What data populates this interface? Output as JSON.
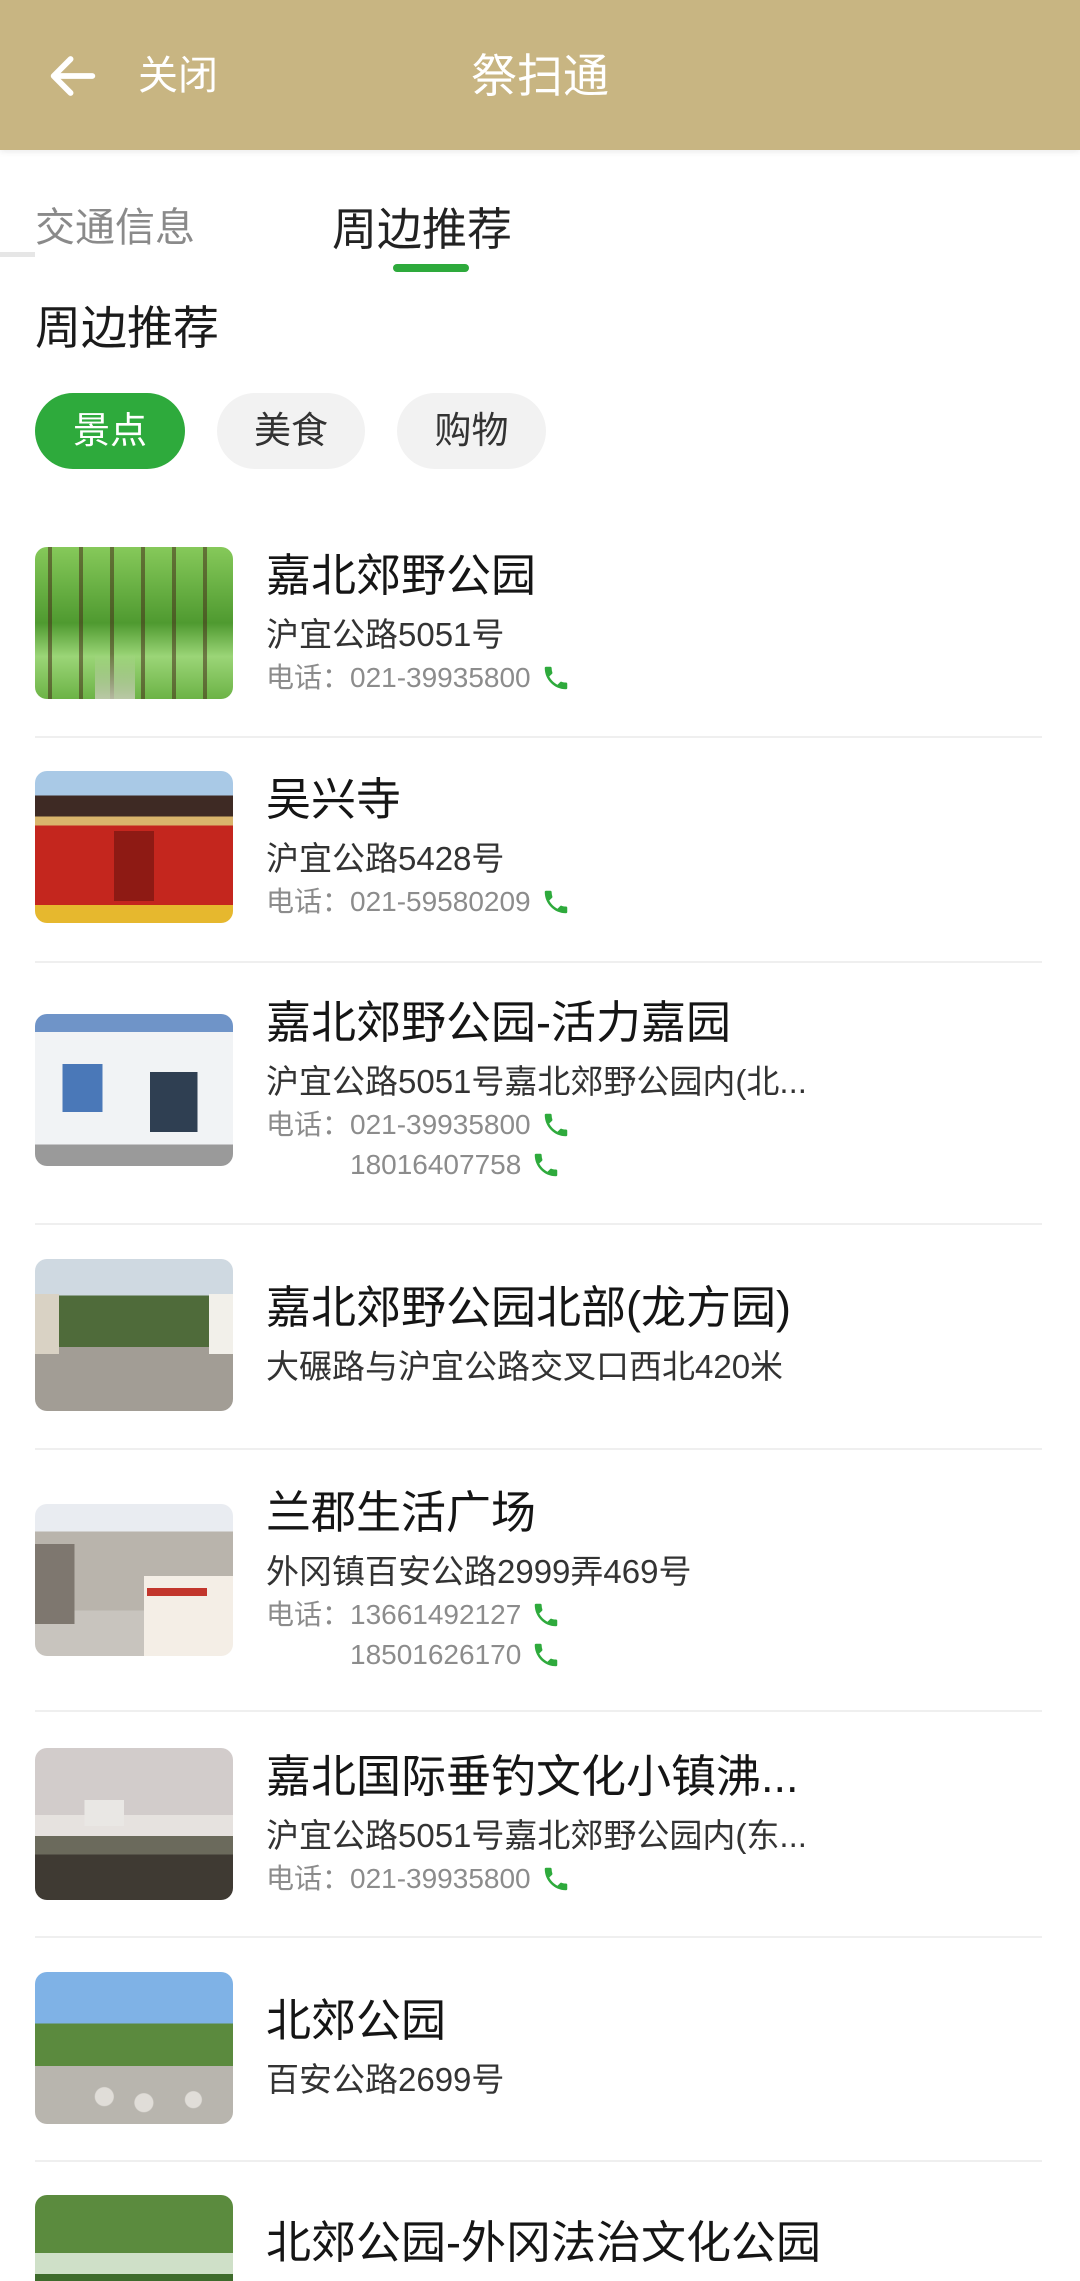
{
  "header": {
    "close_label": "关闭",
    "title": "祭扫通",
    "back_icon": "arrow-left-icon"
  },
  "tabs": [
    {
      "label": "交通信息",
      "active": false
    },
    {
      "label": "周边推荐",
      "active": true
    }
  ],
  "section_title": "周边推荐",
  "categories": [
    {
      "label": "景点",
      "active": true
    },
    {
      "label": "美食",
      "active": false
    },
    {
      "label": "购物",
      "active": false
    }
  ],
  "phone_label": "电话：",
  "phone_icon": "phone-icon",
  "places": [
    {
      "name": "嘉北郊野公园",
      "address": "沪宜公路5051号",
      "phones": [
        "021-39935800"
      ]
    },
    {
      "name": "吴兴寺",
      "address": "沪宜公路5428号",
      "phones": [
        "021-59580209"
      ]
    },
    {
      "name": "嘉北郊野公园-活力嘉园",
      "address": "沪宜公路5051号嘉北郊野公园内(北...",
      "phones": [
        "021-39935800",
        "18016407758"
      ]
    },
    {
      "name": "嘉北郊野公园北部(龙方园)",
      "address": "大碾路与沪宜公路交叉口西北420米",
      "phones": []
    },
    {
      "name": "兰郡生活广场",
      "address": "外冈镇百安公路2999弄469号",
      "phones": [
        "13661492127",
        "18501626170"
      ]
    },
    {
      "name": "嘉北国际垂钓文化小镇沸...",
      "address": "沪宜公路5051号嘉北郊野公园内(东...",
      "phones": [
        "021-39935800"
      ]
    },
    {
      "name": "北郊公园",
      "address": "百安公路2699号",
      "phones": []
    },
    {
      "name": "北郊公园-外冈法治文化公园"
    }
  ],
  "colors": {
    "header": "#c8b582",
    "accent": "#2eaa3c",
    "chip_inactive": "#f2f2f2"
  }
}
